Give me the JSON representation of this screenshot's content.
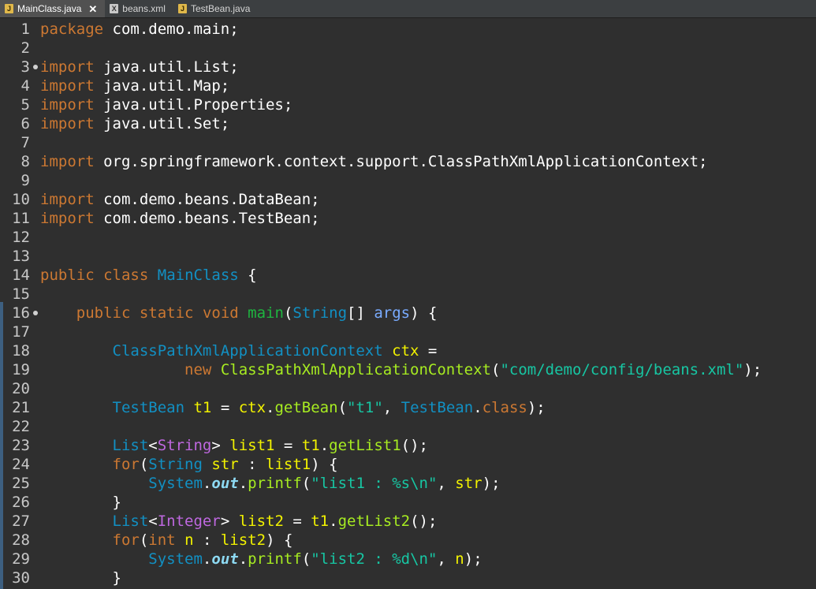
{
  "tabs": [
    {
      "label": "MainClass.java",
      "icon": "java-file-icon",
      "active": true,
      "close": "✕"
    },
    {
      "label": "beans.xml",
      "icon": "xml-file-icon",
      "active": false
    },
    {
      "label": "TestBean.java",
      "icon": "java-file-icon",
      "active": false
    }
  ],
  "colors": {
    "background": "#2f2f2f",
    "keyword": "#cc7832",
    "type": "#1290c3",
    "string": "#17c6a3",
    "variable": "#f2f200",
    "method": "#a7ec21",
    "generic": "#bf68e0"
  },
  "lines": [
    {
      "n": "1",
      "tokens": [
        [
          "kw",
          "package"
        ],
        [
          "pl",
          " com.demo.main;"
        ]
      ]
    },
    {
      "n": "2",
      "tokens": []
    },
    {
      "n": "3",
      "fold": true,
      "tokens": [
        [
          "kw",
          "import"
        ],
        [
          "pl",
          " java.util.List;"
        ]
      ]
    },
    {
      "n": "4",
      "tokens": [
        [
          "kw",
          "import"
        ],
        [
          "pl",
          " java.util.Map;"
        ]
      ]
    },
    {
      "n": "5",
      "tokens": [
        [
          "kw",
          "import"
        ],
        [
          "pl",
          " java.util.Properties;"
        ]
      ]
    },
    {
      "n": "6",
      "tokens": [
        [
          "kw",
          "import"
        ],
        [
          "pl",
          " java.util.Set;"
        ]
      ]
    },
    {
      "n": "7",
      "tokens": []
    },
    {
      "n": "8",
      "tokens": [
        [
          "kw",
          "import"
        ],
        [
          "pl",
          " org.springframework.context.support.ClassPathXmlApplicationContext;"
        ]
      ]
    },
    {
      "n": "9",
      "tokens": []
    },
    {
      "n": "10",
      "tokens": [
        [
          "kw",
          "import"
        ],
        [
          "pl",
          " com.demo.beans.DataBean;"
        ]
      ]
    },
    {
      "n": "11",
      "tokens": [
        [
          "kw",
          "import"
        ],
        [
          "pl",
          " com.demo.beans.TestBean;"
        ]
      ]
    },
    {
      "n": "12",
      "tokens": []
    },
    {
      "n": "13",
      "tokens": []
    },
    {
      "n": "14",
      "tokens": [
        [
          "kw",
          "public"
        ],
        [
          "pl",
          " "
        ],
        [
          "kw",
          "class"
        ],
        [
          "pl",
          " "
        ],
        [
          "cls",
          "MainClass"
        ],
        [
          "pl",
          " {"
        ]
      ]
    },
    {
      "n": "15",
      "tokens": []
    },
    {
      "n": "16",
      "fold": true,
      "tokens": [
        [
          "pl",
          "    "
        ],
        [
          "kw",
          "public"
        ],
        [
          "pl",
          " "
        ],
        [
          "kw",
          "static"
        ],
        [
          "pl",
          " "
        ],
        [
          "kw",
          "void"
        ],
        [
          "pl",
          " "
        ],
        [
          "fn",
          "main"
        ],
        [
          "pl",
          "("
        ],
        [
          "ty",
          "String"
        ],
        [
          "pl",
          "[] "
        ],
        [
          "arg",
          "args"
        ],
        [
          "pl",
          ") {"
        ]
      ]
    },
    {
      "n": "17",
      "tokens": []
    },
    {
      "n": "18",
      "tokens": [
        [
          "pl",
          "        "
        ],
        [
          "ty",
          "ClassPathXmlApplicationContext"
        ],
        [
          "pl",
          " "
        ],
        [
          "var",
          "ctx"
        ],
        [
          "pl",
          " ="
        ]
      ]
    },
    {
      "n": "19",
      "tokens": [
        [
          "pl",
          "                "
        ],
        [
          "kw",
          "new"
        ],
        [
          "pl",
          " "
        ],
        [
          "mth",
          "ClassPathXmlApplicationContext"
        ],
        [
          "pl",
          "("
        ],
        [
          "str",
          "\"com/demo/config/beans.xml\""
        ],
        [
          "pl",
          ");"
        ]
      ]
    },
    {
      "n": "20",
      "tokens": []
    },
    {
      "n": "21",
      "tokens": [
        [
          "pl",
          "        "
        ],
        [
          "ty",
          "TestBean"
        ],
        [
          "pl",
          " "
        ],
        [
          "var",
          "t1"
        ],
        [
          "pl",
          " = "
        ],
        [
          "var",
          "ctx"
        ],
        [
          "pl",
          "."
        ],
        [
          "mth",
          "getBean"
        ],
        [
          "pl",
          "("
        ],
        [
          "str",
          "\"t1\""
        ],
        [
          "pl",
          ", "
        ],
        [
          "ty",
          "TestBean"
        ],
        [
          "pl",
          "."
        ],
        [
          "kw",
          "class"
        ],
        [
          "pl",
          ");"
        ]
      ]
    },
    {
      "n": "22",
      "tokens": []
    },
    {
      "n": "23",
      "tokens": [
        [
          "pl",
          "        "
        ],
        [
          "ty",
          "List"
        ],
        [
          "pl",
          "<"
        ],
        [
          "gen",
          "String"
        ],
        [
          "pl",
          "> "
        ],
        [
          "var",
          "list1"
        ],
        [
          "pl",
          " = "
        ],
        [
          "var",
          "t1"
        ],
        [
          "pl",
          "."
        ],
        [
          "mth",
          "getList1"
        ],
        [
          "pl",
          "();"
        ]
      ]
    },
    {
      "n": "24",
      "tokens": [
        [
          "pl",
          "        "
        ],
        [
          "kw",
          "for"
        ],
        [
          "pl",
          "("
        ],
        [
          "ty",
          "String"
        ],
        [
          "pl",
          " "
        ],
        [
          "var",
          "str"
        ],
        [
          "pl",
          " : "
        ],
        [
          "var",
          "list1"
        ],
        [
          "pl",
          ") {"
        ]
      ]
    },
    {
      "n": "25",
      "tokens": [
        [
          "pl",
          "            "
        ],
        [
          "ty",
          "System"
        ],
        [
          "pl",
          "."
        ],
        [
          "fld",
          "out"
        ],
        [
          "pl",
          "."
        ],
        [
          "mth",
          "printf"
        ],
        [
          "pl",
          "("
        ],
        [
          "str",
          "\"list1 : %s\\n\""
        ],
        [
          "pl",
          ", "
        ],
        [
          "var",
          "str"
        ],
        [
          "pl",
          ");"
        ]
      ]
    },
    {
      "n": "26",
      "tokens": [
        [
          "pl",
          "        }"
        ]
      ]
    },
    {
      "n": "27",
      "tokens": [
        [
          "pl",
          "        "
        ],
        [
          "ty",
          "List"
        ],
        [
          "pl",
          "<"
        ],
        [
          "gen",
          "Integer"
        ],
        [
          "pl",
          "> "
        ],
        [
          "var",
          "list2"
        ],
        [
          "pl",
          " = "
        ],
        [
          "var",
          "t1"
        ],
        [
          "pl",
          "."
        ],
        [
          "mth",
          "getList2"
        ],
        [
          "pl",
          "();"
        ]
      ]
    },
    {
      "n": "28",
      "tokens": [
        [
          "pl",
          "        "
        ],
        [
          "kw",
          "for"
        ],
        [
          "pl",
          "("
        ],
        [
          "kw",
          "int"
        ],
        [
          "pl",
          " "
        ],
        [
          "var",
          "n"
        ],
        [
          "pl",
          " : "
        ],
        [
          "var",
          "list2"
        ],
        [
          "pl",
          ") {"
        ]
      ]
    },
    {
      "n": "29",
      "tokens": [
        [
          "pl",
          "            "
        ],
        [
          "ty",
          "System"
        ],
        [
          "pl",
          "."
        ],
        [
          "fld",
          "out"
        ],
        [
          "pl",
          "."
        ],
        [
          "mth",
          "printf"
        ],
        [
          "pl",
          "("
        ],
        [
          "str",
          "\"list2 : %d\\n\""
        ],
        [
          "pl",
          ", "
        ],
        [
          "var",
          "n"
        ],
        [
          "pl",
          ");"
        ]
      ]
    },
    {
      "n": "30",
      "tokens": [
        [
          "pl",
          "        }"
        ]
      ]
    }
  ]
}
